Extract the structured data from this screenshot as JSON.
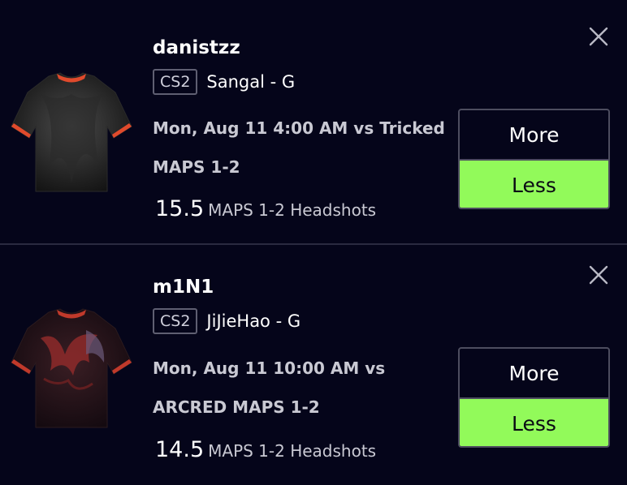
{
  "accent_color": "#92fa5a",
  "picks": [
    {
      "player": "danistzz",
      "game_badge": "CS2",
      "team": "Sangal - G",
      "line1": "Mon, Aug 11 4:00 AM vs Tricked",
      "line2": "MAPS 1-2",
      "stat_value": "15.5",
      "stat_label": "MAPS 1-2 Headshots",
      "more_label": "More",
      "less_label": "Less",
      "selected": "Less",
      "jersey_icon": "black-jersey-icon",
      "close_icon": "close-icon"
    },
    {
      "player": "m1N1",
      "game_badge": "CS2",
      "team": "JiJieHao - G",
      "line1": "Mon, Aug 11 10:00 AM vs",
      "line2": "ARCRED MAPS 1-2",
      "stat_value": "14.5",
      "stat_label": "MAPS 1-2 Headshots",
      "more_label": "More",
      "less_label": "Less",
      "selected": "Less",
      "jersey_icon": "dragon-jersey-icon",
      "close_icon": "close-icon"
    }
  ]
}
